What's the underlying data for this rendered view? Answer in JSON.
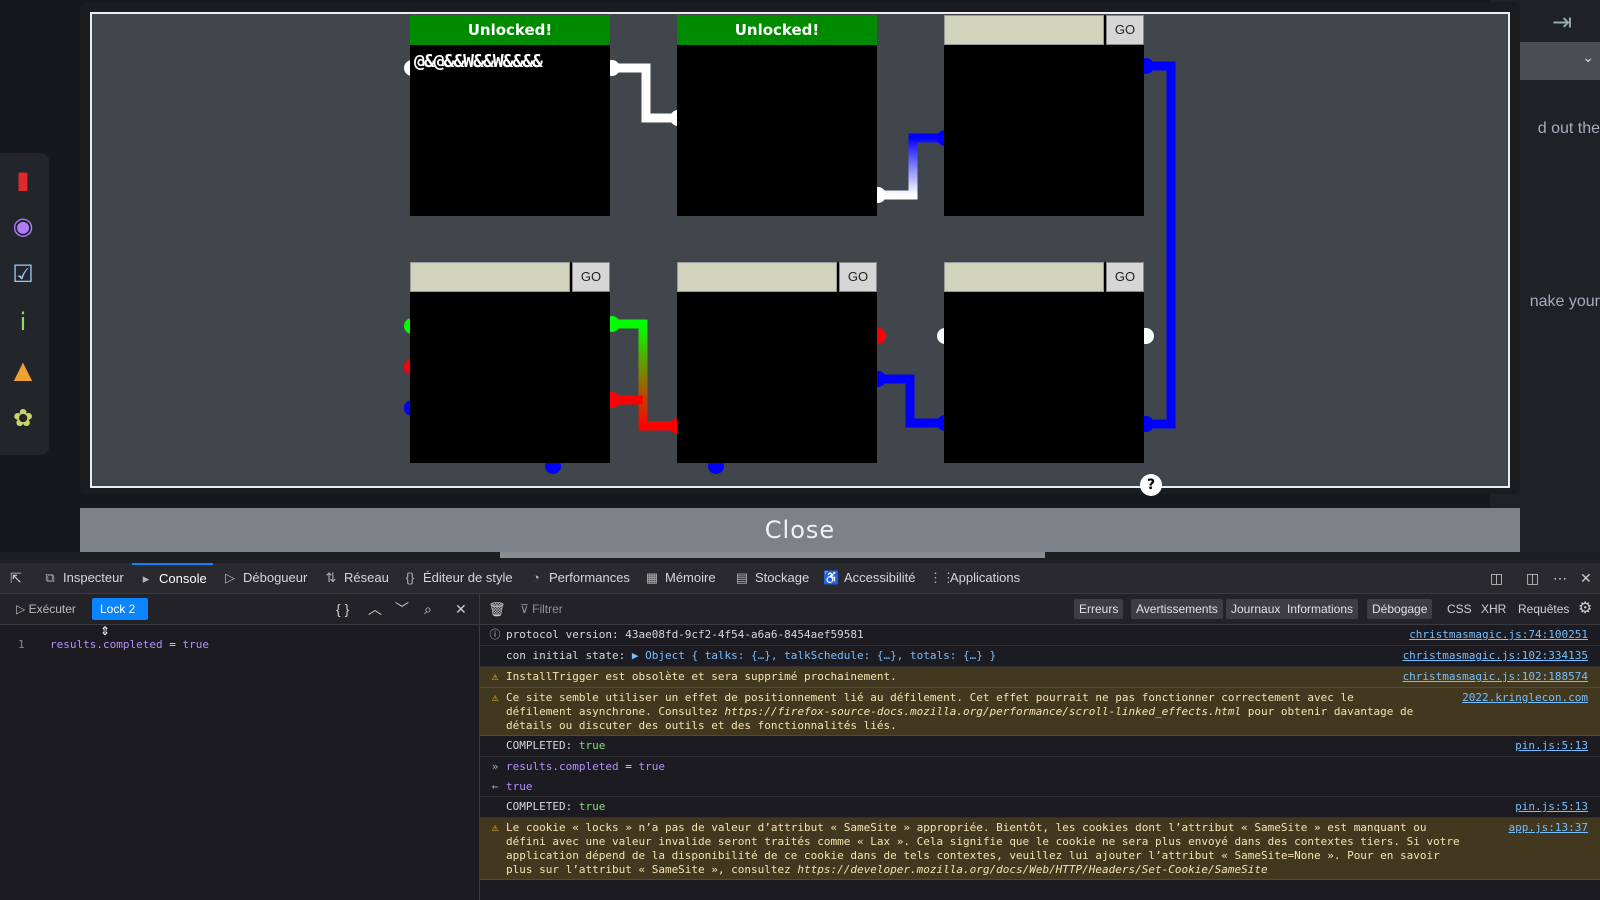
{
  "background": {
    "text_1": "d out the",
    "text_2": "nake your",
    "select_chevron": "⌄"
  },
  "sidebar_icons": [
    "book-icon",
    "map-pin-icon",
    "checkbox-icon",
    "info-icon",
    "hat-icon",
    "badge-icon"
  ],
  "locks": [
    {
      "id": "lock-1",
      "status": "unlocked",
      "header": "Unlocked!",
      "output": "@&@&&W&&W&&&&"
    },
    {
      "id": "lock-2",
      "status": "unlocked",
      "header": "Unlocked!",
      "output": ""
    },
    {
      "id": "lock-3",
      "status": "locked",
      "go": "GO",
      "input": ""
    },
    {
      "id": "lock-4",
      "status": "locked",
      "go": "GO",
      "input": ""
    },
    {
      "id": "lock-5",
      "status": "locked",
      "go": "GO",
      "input": ""
    },
    {
      "id": "lock-6",
      "status": "locked",
      "go": "GO",
      "input": ""
    }
  ],
  "help_button": "?",
  "close_label": "Close",
  "devtools": {
    "tabs": [
      {
        "label": "Inspecteur",
        "icon": "⧉"
      },
      {
        "label": "Console",
        "icon": "▸",
        "active": true
      },
      {
        "label": "Débogueur",
        "icon": "▷"
      },
      {
        "label": "Réseau",
        "icon": "⇅"
      },
      {
        "label": "Éditeur de style",
        "icon": "{}"
      },
      {
        "label": "Performances",
        "icon": "◔"
      },
      {
        "label": "Mémoire",
        "icon": "▦"
      },
      {
        "label": "Stockage",
        "icon": "▤"
      },
      {
        "label": "Accessibilité",
        "icon": "♿"
      },
      {
        "label": "Applications",
        "icon": "⋮⋮"
      }
    ],
    "editor": {
      "run_label": "Exécuter",
      "context": "Lock 2",
      "line_number": "1",
      "code_prop": "results.completed",
      "code_eq": " = ",
      "code_val": "true"
    },
    "console": {
      "filter_placeholder": "Filtrer",
      "filters": [
        "Erreurs",
        "Avertissements",
        "Journaux",
        "Informations",
        "Débogage"
      ],
      "filters_plain": [
        "CSS",
        "XHR",
        "Requêtes"
      ],
      "messages": [
        {
          "type": "info",
          "text": "protocol version: 43ae08fd-9cf2-4f54-a6a6-8454aef59581",
          "source": "christmasmagic.js:74:100251"
        },
        {
          "type": "log",
          "prefix": "con initial state: ",
          "text": "▶ Object { talks: {…}, talkSchedule: {…}, totals: {…} }",
          "source": "christmasmagic.js:102:334135"
        },
        {
          "type": "warn",
          "text": "InstallTrigger est obsolète et sera supprimé prochainement.",
          "source": "christmasmagic.js:102:188574"
        },
        {
          "type": "warn",
          "text": "Ce site semble utiliser un effet de positionnement lié au défilement. Cet effet pourrait ne pas fonctionner correctement avec le défilement asynchrone. Consultez ",
          "url": "https://firefox-source-docs.mozilla.org/performance/scroll-linked_effects.html",
          "text2": " pour obtenir davantage de détails ou discuter des outils et des fonctionnalités liés.",
          "source": "2022.kringlecon.com"
        },
        {
          "type": "log",
          "prefix": "COMPLETED: ",
          "value": "true",
          "source": "pin.js:5:13"
        },
        {
          "type": "input",
          "prefix": "results.completed",
          "text": " = ",
          "value": "true"
        },
        {
          "type": "result",
          "value": "true"
        },
        {
          "type": "log",
          "prefix": "COMPLETED: ",
          "value": "true",
          "source": "pin.js:5:13"
        },
        {
          "type": "warn",
          "text": "Le cookie « locks » n’a pas de valeur d’attribut « SameSite » appropriée. Bientôt, les cookies dont l’attribut « SameSite » est manquant ou défini avec une valeur invalide seront traités comme « Lax ». Cela signifie que le cookie ne sera plus envoyé dans des contextes tiers. Si votre application dépend de la disponibilité de ce cookie dans de tels contextes, veuillez lui ajouter l’attribut « SameSite=None ». Pour en savoir plus sur l’attribut « SameSite », consultez ",
          "url": "https://developer.mozilla.org/docs/Web/HTTP/Headers/Set-Cookie/SameSite",
          "text2": "",
          "source": "app.js:13:37"
        }
      ]
    }
  }
}
